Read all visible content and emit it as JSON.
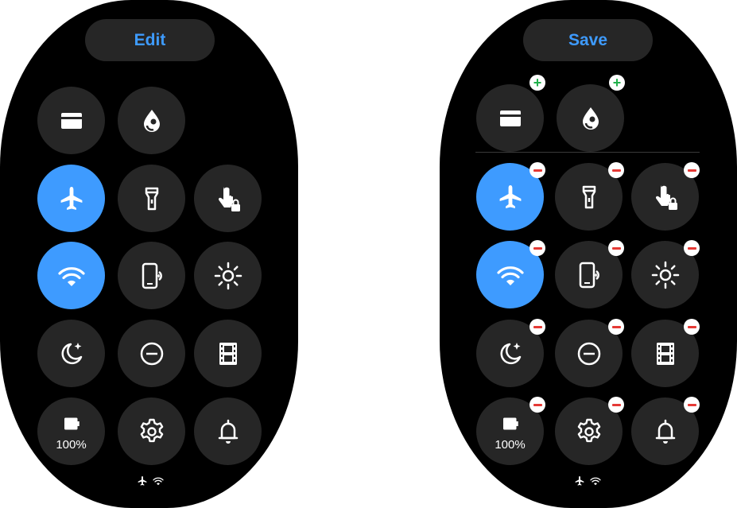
{
  "left_panel": {
    "edit_label": "Edit",
    "tiles": [
      {
        "name": "wallet-tile",
        "icon": "wallet-icon",
        "active": false
      },
      {
        "name": "water-lock-tile",
        "icon": "water-drop-icon",
        "active": false
      },
      {
        "name": "airplane-mode-tile",
        "icon": "airplane-icon",
        "active": true
      },
      {
        "name": "flashlight-tile",
        "icon": "flashlight-icon",
        "active": false
      },
      {
        "name": "touch-lock-tile",
        "icon": "touch-lock-icon",
        "active": false
      },
      {
        "name": "wifi-tile",
        "icon": "wifi-icon",
        "active": true
      },
      {
        "name": "find-phone-tile",
        "icon": "find-phone-icon",
        "active": false
      },
      {
        "name": "brightness-tile",
        "icon": "brightness-icon",
        "active": false
      },
      {
        "name": "bedtime-tile",
        "icon": "moon-icon",
        "active": false
      },
      {
        "name": "do-not-disturb-tile",
        "icon": "minus-circle-icon",
        "active": false
      },
      {
        "name": "theater-mode-tile",
        "icon": "film-icon",
        "active": false
      },
      {
        "name": "battery-tile",
        "icon": "battery-icon",
        "active": false
      },
      {
        "name": "settings-tile",
        "icon": "gear-icon",
        "active": false
      },
      {
        "name": "sound-tile",
        "icon": "bell-icon",
        "active": false
      }
    ],
    "battery_label": "100%",
    "status_icons": [
      "airplane-icon",
      "wifi-icon"
    ]
  },
  "right_panel": {
    "save_label": "Save",
    "battery_label": "100%",
    "add_badge_symbol": "+",
    "status_icons": [
      "airplane-icon",
      "wifi-icon"
    ]
  },
  "colors": {
    "accent": "#3e9bff",
    "tile_bg": "#262626",
    "remove_badge": "#e53935",
    "add_badge": "#22b14c"
  }
}
